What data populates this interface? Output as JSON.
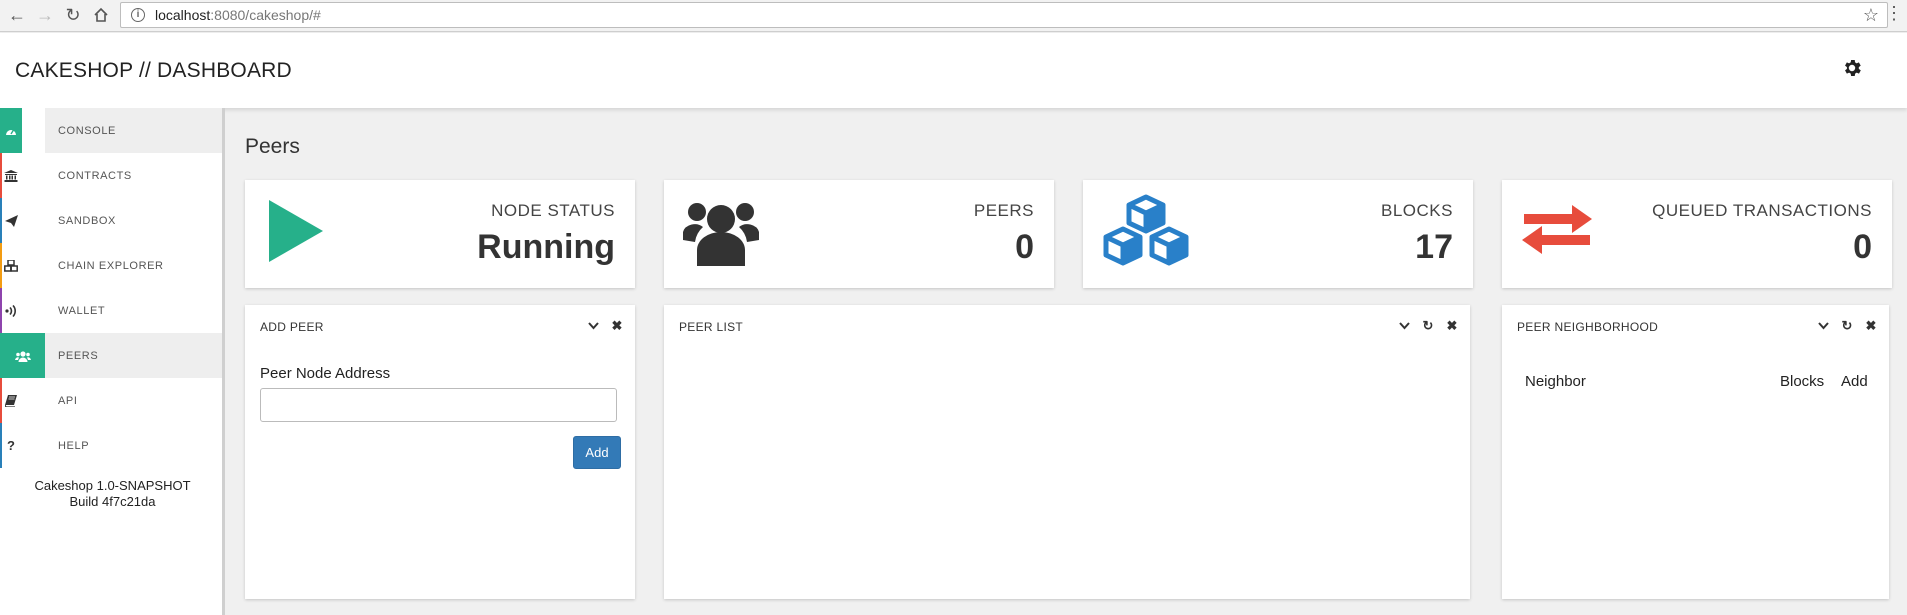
{
  "browser": {
    "url_host": "localhost",
    "url_rest": ":8080/cakeshop/#"
  },
  "header": {
    "title": "CAKESHOP // DASHBOARD"
  },
  "sidebar": {
    "items": [
      {
        "label": "CONSOLE",
        "icon": "dashboard-icon",
        "color": "#26b08a"
      },
      {
        "label": "CONTRACTS",
        "icon": "bank-icon",
        "color": "#e74c3c"
      },
      {
        "label": "SANDBOX",
        "icon": "paper-plane-icon",
        "color": "#2980b9"
      },
      {
        "label": "CHAIN EXPLORER",
        "icon": "cubes-icon",
        "color": "#f39c12"
      },
      {
        "label": "WALLET",
        "icon": "wifi-icon",
        "color": "#8e44ad"
      },
      {
        "label": "PEERS",
        "icon": "users-icon",
        "color": "#26b08a"
      },
      {
        "label": "API",
        "icon": "book-icon",
        "color": "#e74c3c"
      },
      {
        "label": "HELP",
        "icon": "question-icon",
        "color": "#2980b9"
      }
    ],
    "version_line1": "Cakeshop 1.0-SNAPSHOT",
    "version_line2": "Build 4f7c21da"
  },
  "main": {
    "page_title": "Peers",
    "stats": [
      {
        "label": "NODE STATUS",
        "value": "Running",
        "icon": "play-icon",
        "color": "#26b08a"
      },
      {
        "label": "PEERS",
        "value": "0",
        "icon": "users-icon",
        "color": "#333333"
      },
      {
        "label": "BLOCKS",
        "value": "17",
        "icon": "cubes-icon",
        "color": "#2980c9"
      },
      {
        "label": "QUEUED TRANSACTIONS",
        "value": "0",
        "icon": "exchange-icon",
        "color": "#e74c3c"
      }
    ],
    "add_peer": {
      "title": "ADD PEER",
      "field_label": "Peer Node Address",
      "field_value": "",
      "button": "Add"
    },
    "peer_list": {
      "title": "PEER LIST"
    },
    "peer_neighborhood": {
      "title": "PEER NEIGHBORHOOD",
      "columns": [
        "Neighbor",
        "Blocks",
        "Add"
      ]
    }
  }
}
